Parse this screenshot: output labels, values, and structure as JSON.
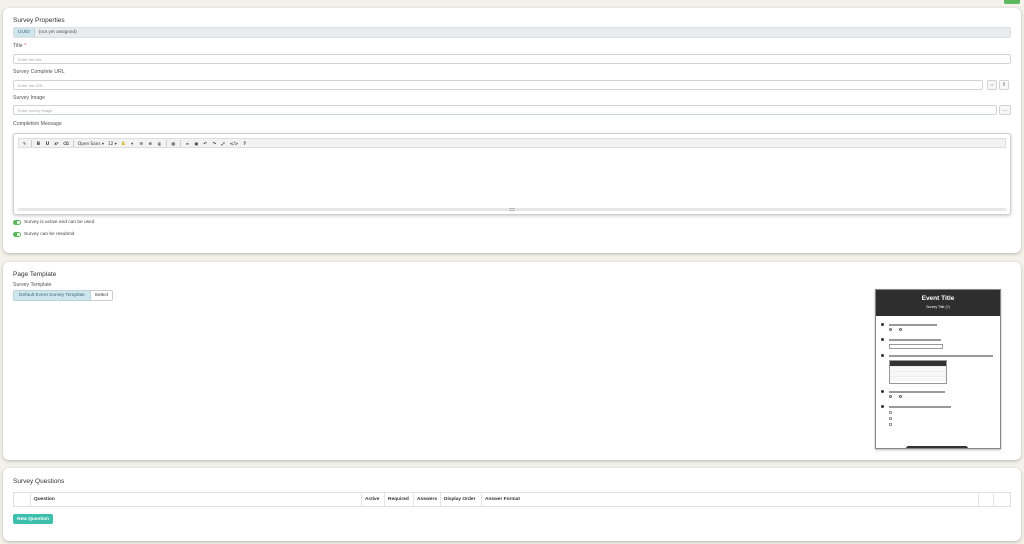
{
  "props": {
    "title": "Survey Properties",
    "uuid_label": "UUID",
    "uuid_value": "(not yet assigned)",
    "title_label": "Title",
    "title_required_mark": "*",
    "title_placeholder": "Enter the title",
    "url_label": "Survey Complete URL",
    "url_placeholder": "Enter the URL",
    "image_label": "Survey Image",
    "image_placeholder": "Enter survey image",
    "image_browse": "...",
    "completion_label": "Completion Message",
    "toolbar": {
      "font_family": "Open Sans",
      "font_size": "12"
    },
    "toggle_active": "Survey is active and can be used",
    "toggle_resubmit": "Survey can be resubmit"
  },
  "template": {
    "title": "Page Template",
    "field_label": "Survey Template",
    "selected": "Default Event Survey Template",
    "select_btn": "Select",
    "preview": {
      "event_title": "Event Title",
      "survey_title": "Survey Title (?)"
    }
  },
  "questions": {
    "title": "Survey Questions",
    "columns": [
      "",
      "Question",
      "Active",
      "Required",
      "Answers",
      "Display Order",
      "Answer Format",
      "",
      ""
    ],
    "new_button": "New Question"
  },
  "colors": {
    "accent_teal": "#3dbfae",
    "toggle_green": "#5cb85c",
    "save_green": "#5cb85c"
  }
}
